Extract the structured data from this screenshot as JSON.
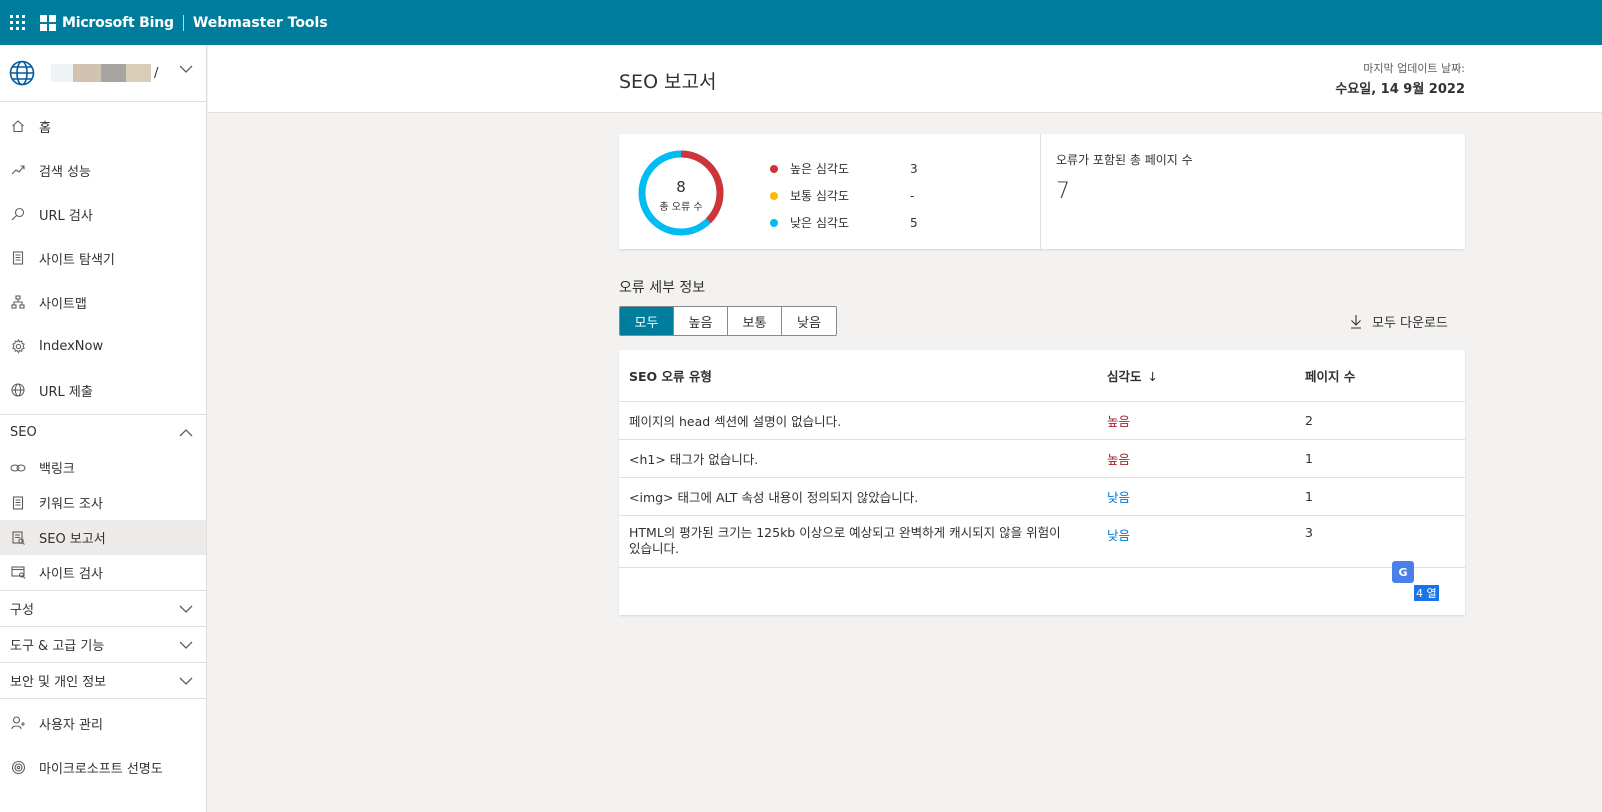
{
  "topbar": {
    "brand": "Microsoft Bing",
    "product": "Webmaster Tools"
  },
  "sidebar": {
    "site_suffix": "/",
    "items": [
      {
        "label": "홈",
        "icon": "home-icon"
      },
      {
        "label": "검색 성능",
        "icon": "trend-icon"
      },
      {
        "label": "URL 검사",
        "icon": "search-icon"
      },
      {
        "label": "사이트 탐색기",
        "icon": "document-icon"
      },
      {
        "label": "사이트맵",
        "icon": "sitemap-icon"
      },
      {
        "label": "IndexNow",
        "icon": "gear-icon"
      },
      {
        "label": "URL 제출",
        "icon": "globe-icon"
      }
    ],
    "seo_section": "SEO",
    "seo_items": [
      {
        "label": "백링크",
        "icon": "link-icon"
      },
      {
        "label": "키워드 조사",
        "icon": "document-icon"
      },
      {
        "label": "SEO 보고서",
        "icon": "report-icon"
      },
      {
        "label": "사이트 검사",
        "icon": "site-scan-icon"
      }
    ],
    "config_section": "구성",
    "tools_section": "도구 & 고급 기능",
    "security_section": "보안 및 개인 정보",
    "user_mgmt": "사용자 관리",
    "ms_clarity": "마이크로소프트 선명도"
  },
  "header": {
    "title": "SEO 보고서",
    "update_label": "마지막 업데이트 날짜:",
    "update_date": "수요일, 14 9월 2022"
  },
  "summary": {
    "total_errors": "8",
    "total_errors_label": "총 오류 수",
    "legend": [
      {
        "label": "높은 심각도",
        "value": "3",
        "color": "#d13438"
      },
      {
        "label": "보통 심각도",
        "value": "-",
        "color": "#ffb900"
      },
      {
        "label": "낮은 심각도",
        "value": "5",
        "color": "#00bcf2"
      }
    ],
    "pages_label": "오류가 포함된 총 페이지 수",
    "pages_value": "7"
  },
  "detail": {
    "title": "오류 세부 정보",
    "filters": [
      "모두",
      "높음",
      "보통",
      "낮음"
    ],
    "active_filter": "모두",
    "download": "모두 다운로드"
  },
  "table": {
    "headers": {
      "type": "SEO 오류 유형",
      "severity": "심각도",
      "pages": "페이지 수"
    },
    "rows": [
      {
        "type": "페이지의 head 섹션에 설명이 없습니다.",
        "severity": "높음",
        "sev_level": "high",
        "pages": "2"
      },
      {
        "type": "<h1> 태그가 없습니다.",
        "severity": "높음",
        "sev_level": "high",
        "pages": "1"
      },
      {
        "type": "<img> 태그에 ALT 속성 내용이 정의되지 않았습니다.",
        "severity": "낮음",
        "sev_level": "low",
        "pages": "1"
      },
      {
        "type": "HTML의 평가된 크기는 125kb 이상으로 예상되고 완벽하게 캐시되지 않을 위험이 있습니다.",
        "severity": "낮음",
        "sev_level": "low",
        "pages": "3"
      }
    ],
    "column_count": "4 열"
  },
  "colors": {
    "brand": "#007c9c",
    "high": "#a4262c",
    "low": "#0078d4"
  }
}
